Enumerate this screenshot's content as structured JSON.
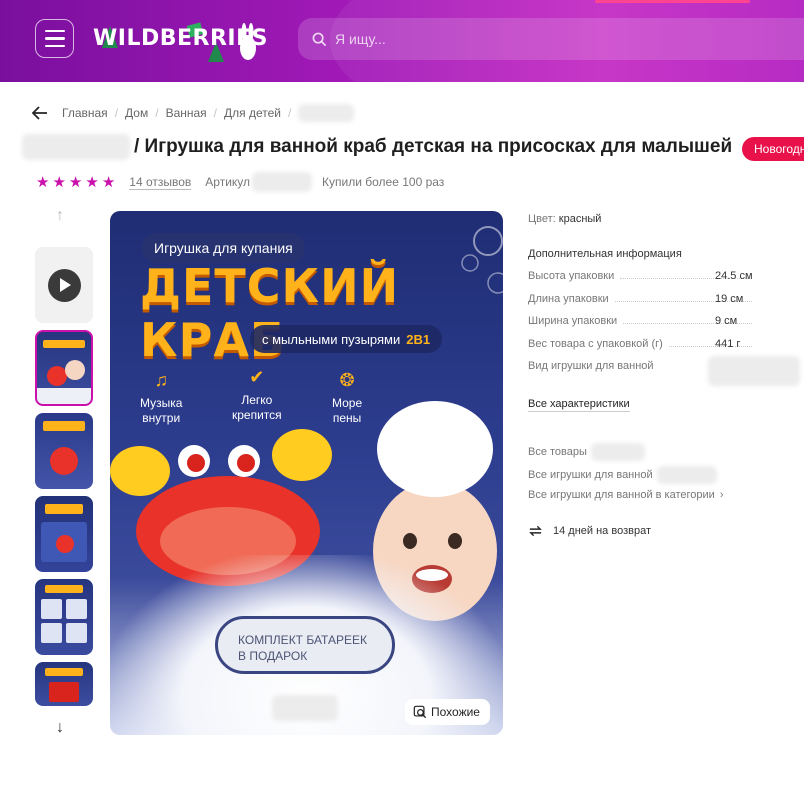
{
  "header": {
    "logo": "WILDBERRIES",
    "search_placeholder": "Я ищу...",
    "colors": {
      "gradient_start": "#7a0f9e",
      "gradient_end": "#c42bc4",
      "accent": "#cb11ab"
    }
  },
  "breadcrumb": {
    "items": [
      "Главная",
      "Дом",
      "Ванная",
      "Для детей"
    ]
  },
  "product": {
    "title": "/ Игрушка для ванной краб детская на присосках для малышей",
    "badge": "Новогодн",
    "rating_stars": 5,
    "reviews": "14 отзывов",
    "article_label": "Артикул",
    "bought": "Купили более 100 раз"
  },
  "gallery": {
    "image": {
      "pill_top": "Игрушка для купания",
      "headline": "ДЕТСКИЙ КРАБ",
      "pill_sub": "с мыльными пузырями",
      "pill_sub_accent": "2В1",
      "features": [
        {
          "line1": "Музыка",
          "line2": "внутри",
          "icon": "music-note-icon"
        },
        {
          "line1": "Легко",
          "line2": "крепится",
          "icon": "check-badge-icon"
        },
        {
          "line1": "Море",
          "line2": "пены",
          "icon": "bubbles-icon"
        }
      ],
      "gift_line1": "КОМПЛЕКТ БАТАРЕЕК",
      "gift_line2": "В ПОДАРОК"
    },
    "similar_button": "Похожие"
  },
  "specs": {
    "color_label": "Цвет:",
    "color_value": "красный",
    "additional_title": "Дополнительная информация",
    "rows": [
      {
        "label": "Высота упаковки",
        "value": "24.5 см"
      },
      {
        "label": "Длина упаковки",
        "value": "19 см"
      },
      {
        "label": "Ширина упаковки",
        "value": "9 см"
      },
      {
        "label": "Вес товара с упаковкой (г)",
        "value": "441 г"
      },
      {
        "label": "Вид игрушки для ванной",
        "value": ""
      }
    ],
    "all_characteristics": "Все характеристики"
  },
  "links": {
    "all_products": "Все товары",
    "all_bath_toys": "Все игрушки для ванной",
    "all_bath_toys_in_category": "Все игрушки для ванной в категории",
    "return_policy": "14 дней на возврат"
  }
}
